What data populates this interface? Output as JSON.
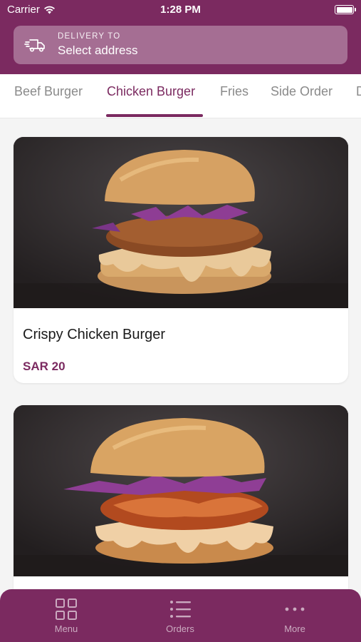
{
  "status_bar": {
    "carrier": "Carrier",
    "time": "1:28 PM"
  },
  "delivery": {
    "label": "DELIVERY TO",
    "value": "Select address",
    "icon": "delivery-truck-icon"
  },
  "tabs": [
    {
      "label": "Beef Burger"
    },
    {
      "label": "Chicken Burger",
      "active": true
    },
    {
      "label": "Fries"
    },
    {
      "label": "Side Order"
    },
    {
      "label": "D"
    }
  ],
  "products": [
    {
      "name": "Crispy Chicken Burger",
      "price": "SAR 20"
    },
    {
      "name": "",
      "price": ""
    }
  ],
  "bottom_nav": {
    "menu": "Menu",
    "orders": "Orders",
    "more": "More"
  },
  "colors": {
    "brand": "#7b2a60",
    "background": "#f4f4f4"
  }
}
